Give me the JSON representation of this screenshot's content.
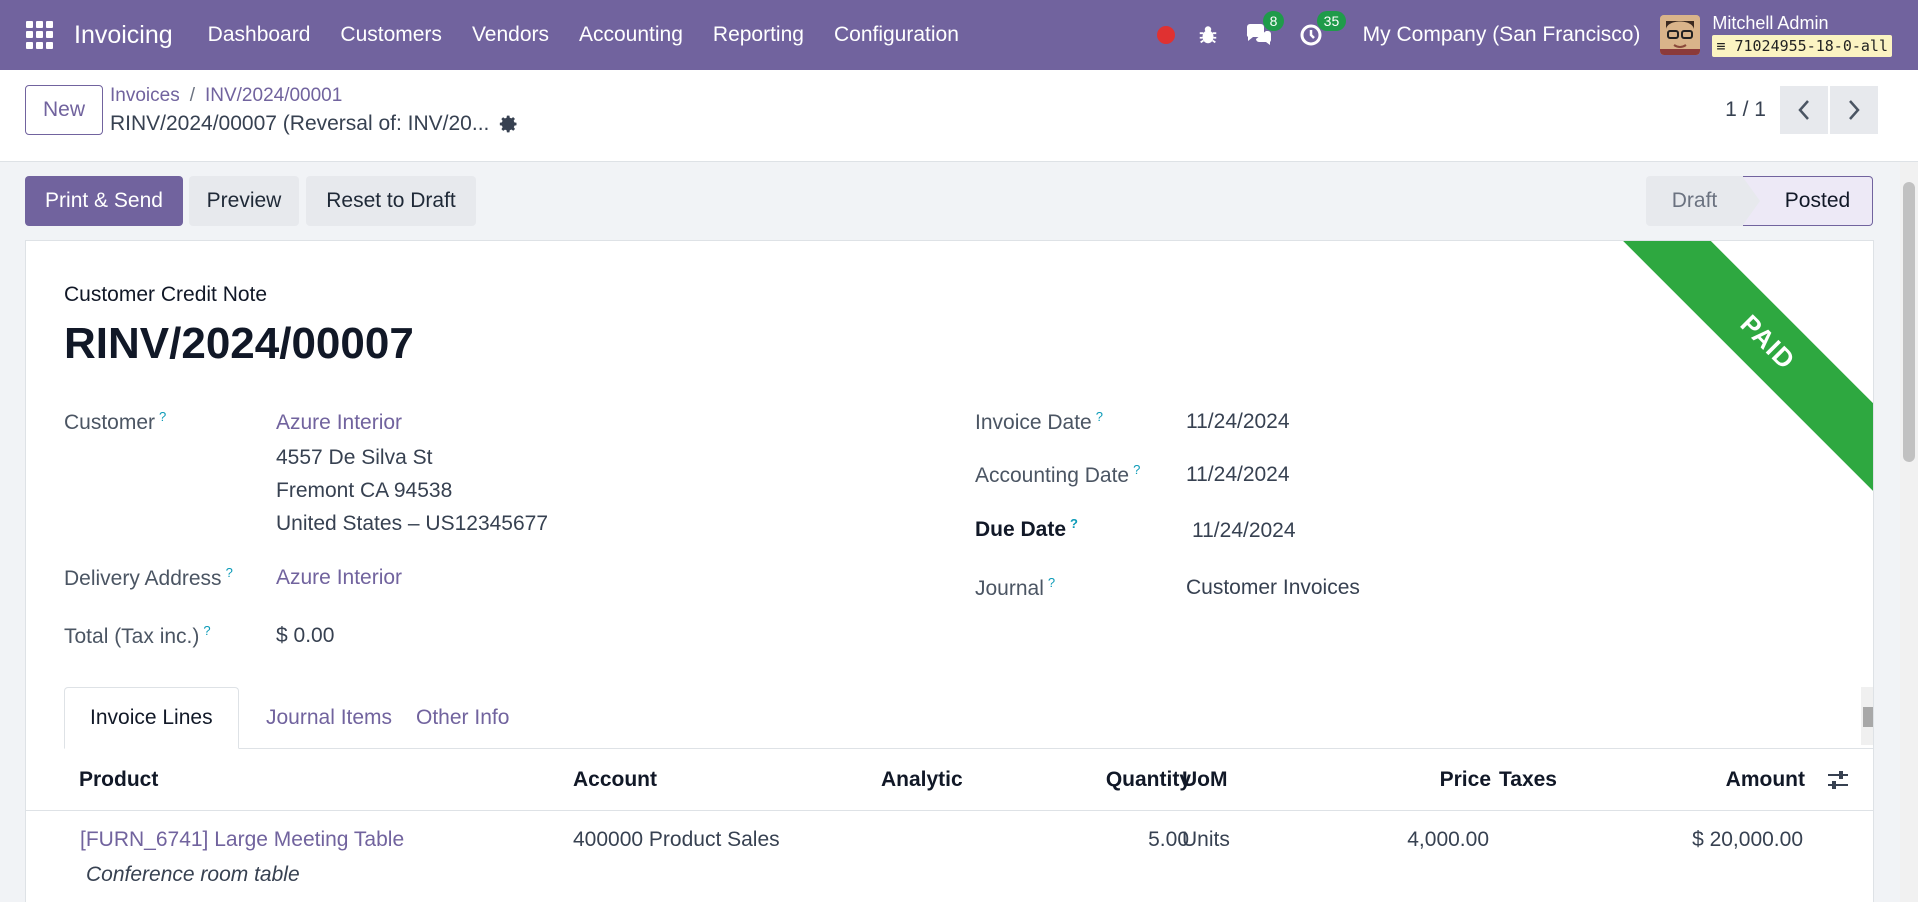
{
  "navbar": {
    "app_name": "Invoicing",
    "menu": [
      "Dashboard",
      "Customers",
      "Vendors",
      "Accounting",
      "Reporting",
      "Configuration"
    ],
    "messages_count": "8",
    "activities_count": "35",
    "company": "My Company (San Francisco)",
    "user_name": "Mitchell Admin",
    "database": "71024955-18-0-all",
    "accent_color": "#71639e"
  },
  "control": {
    "new_label": "New",
    "breadcrumb": [
      "Invoices",
      "INV/2024/00001"
    ],
    "record_title": "RINV/2024/00007 (Reversal of: INV/20...",
    "pager": "1 / 1"
  },
  "actions": {
    "print_send": "Print & Send",
    "preview": "Preview",
    "reset_to_draft": "Reset to Draft"
  },
  "status": {
    "stages": [
      "Draft",
      "Posted"
    ],
    "current": "Posted"
  },
  "form": {
    "ribbon": "PAID",
    "doc_type": "Customer Credit Note",
    "doc_name": "RINV/2024/00007",
    "customer_label": "Customer",
    "customer_name": "Azure Interior",
    "customer_address": [
      "4557 De Silva St",
      "Fremont CA 94538",
      "United States – US12345677"
    ],
    "delivery_label": "Delivery Address",
    "delivery_value": "Azure Interior",
    "total_label": "Total (Tax inc.)",
    "total_value": "$ 0.00",
    "invoice_date_label": "Invoice Date",
    "invoice_date": "11/24/2024",
    "accounting_date_label": "Accounting Date",
    "accounting_date": "11/24/2024",
    "due_date_label": "Due Date",
    "due_date": "11/24/2024",
    "journal_label": "Journal",
    "journal": "Customer Invoices",
    "help_mark": "?"
  },
  "tabs": [
    "Invoice Lines",
    "Journal Items",
    "Other Info"
  ],
  "lines": {
    "columns": [
      "Product",
      "Account",
      "Analytic",
      "Quantity",
      "UoM",
      "Price",
      "Taxes",
      "Amount"
    ],
    "rows": [
      {
        "product": "[FURN_6741] Large Meeting Table",
        "description": "Conference room table",
        "account": "400000 Product Sales",
        "analytic": "",
        "quantity": "5.00",
        "uom": "Units",
        "price": "4,000.00",
        "taxes": "",
        "amount": "$ 20,000.00"
      }
    ]
  }
}
